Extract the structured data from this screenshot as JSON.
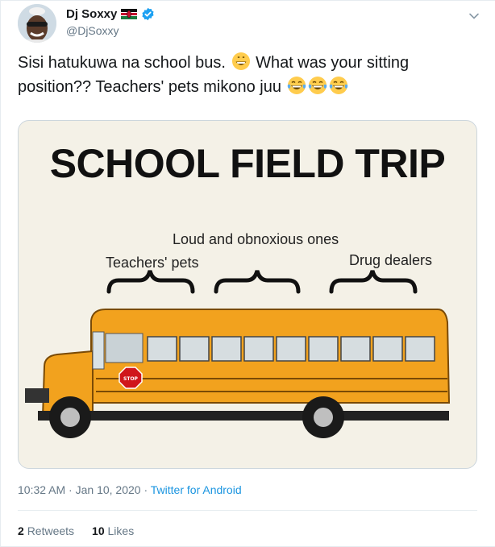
{
  "user": {
    "display_name": "Dj Soxxy",
    "handle": "@DjSoxxy",
    "verified": true,
    "flag_icon": "kenya-flag-icon"
  },
  "tweet": {
    "text_part1": "Sisi hatukuwa na school bus.",
    "text_part2": "What was your sitting position??  Teachers' pets mikono juu",
    "emojis": [
      "grinning-face-icon",
      "tears-of-joy-icon",
      "tears-of-joy-icon",
      "tears-of-joy-icon"
    ]
  },
  "media": {
    "title": "SCHOOL FIELD TRIP",
    "labels": {
      "middle": "Loud and obnoxious ones",
      "front": "Teachers' pets",
      "back": "Drug dealers"
    },
    "stop_sign": "STOP",
    "bus_color": "#f2a21e"
  },
  "meta": {
    "time": "10:32 AM",
    "date": "Jan 10, 2020",
    "source": "Twitter for Android"
  },
  "stats": {
    "retweets_count": "2",
    "retweets_label": "Retweets",
    "likes_count": "10",
    "likes_label": "Likes"
  },
  "colors": {
    "link": "#1b95e0",
    "secondary_text": "#657786",
    "verified": "#1da1f2"
  }
}
